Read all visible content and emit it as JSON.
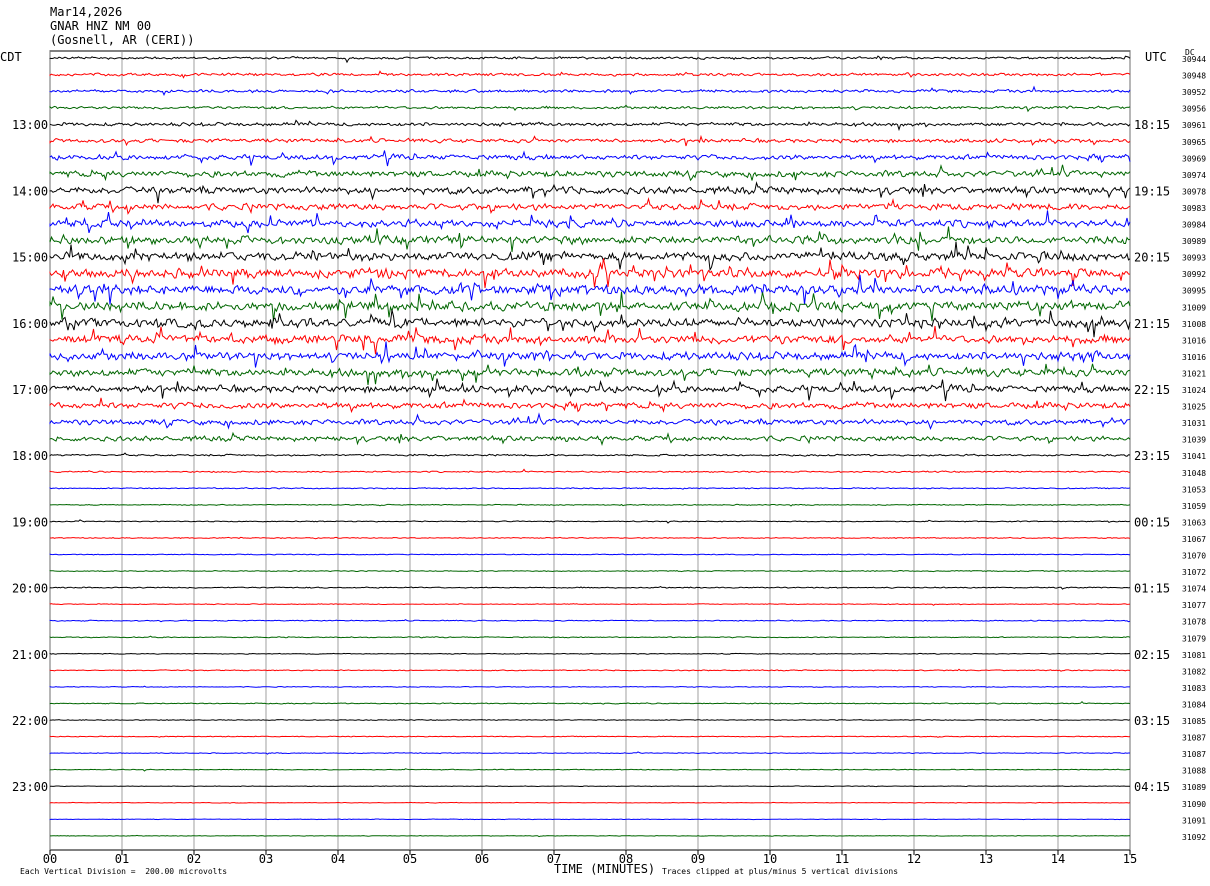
{
  "header": {
    "date": "Mar14,2026",
    "station": "GNAR HNZ NM 00",
    "location": "(Gosnell, AR (CERI))"
  },
  "left_zone": "CDT",
  "right_zone": "UTC",
  "dc_header": "DC",
  "footer": {
    "vertical_division": "Each Vertical Division =  200.00 microvolts",
    "xlabel": "TIME (MINUTES)",
    "clip_note": "Traces clipped at plus/minus 5 vertical divisions"
  },
  "chart_data": {
    "type": "line",
    "xlabel": "TIME (MINUTES)",
    "xlim": [
      0,
      15
    ],
    "x_ticks": [
      "00",
      "01",
      "02",
      "03",
      "04",
      "05",
      "06",
      "07",
      "08",
      "09",
      "10",
      "11",
      "12",
      "13",
      "14",
      "15"
    ],
    "grid": true,
    "trace_colors": [
      "#000000",
      "#ff0000",
      "#0000ff",
      "#006600"
    ],
    "left_hour_labels": [
      "13:00",
      "14:00",
      "15:00",
      "16:00",
      "17:00",
      "18:00",
      "19:00",
      "20:00",
      "21:00",
      "22:00",
      "23:00"
    ],
    "right_hour_labels": [
      "18:15",
      "19:15",
      "20:15",
      "21:15",
      "22:15",
      "23:15",
      "00:15",
      "01:15",
      "02:15",
      "03:15",
      "04:15"
    ],
    "dc_offsets": [
      30944,
      30948,
      30952,
      30956,
      30961,
      30965,
      30969,
      30974,
      30978,
      30983,
      30984,
      30989,
      30993,
      30992,
      30995,
      31009,
      31008,
      31016,
      31016,
      31021,
      31024,
      31025,
      31031,
      31039,
      31041,
      31048,
      31053,
      31059,
      31063,
      31067,
      31070,
      31072,
      31074,
      31077,
      31078,
      31079,
      31081,
      31082,
      31083,
      31084,
      31085,
      31087,
      31087,
      31088,
      31089,
      31090,
      31091,
      31092
    ],
    "trace_activity": [
      1.2,
      1.4,
      1.5,
      1.4,
      1.8,
      2.0,
      2.6,
      3.2,
      3.6,
      3.4,
      3.8,
      4.2,
      4.6,
      4.8,
      5.0,
      4.8,
      4.6,
      4.4,
      4.2,
      4.0,
      3.6,
      3.2,
      2.8,
      2.6,
      0.9,
      0.7,
      0.6,
      0.5,
      0.5,
      0.5,
      0.4,
      0.5,
      0.6,
      0.4,
      0.5,
      0.5,
      0.4,
      0.5,
      0.4,
      0.5,
      0.4,
      0.4,
      0.4,
      0.4,
      0.3,
      0.3,
      0.3,
      0.3
    ]
  }
}
